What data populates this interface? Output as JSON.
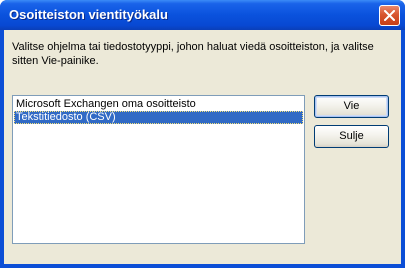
{
  "window": {
    "title": "Osoitteiston vientityökalu"
  },
  "dialog": {
    "instructions": "Valitse ohjelma tai tiedostotyyppi, johon haluat viedä osoitteiston, ja valitse sitten Vie-painike.",
    "list_items": [
      {
        "label": "Microsoft Exchangen oma osoitteisto",
        "selected": false
      },
      {
        "label": "Tekstitiedosto (CSV)",
        "selected": true
      }
    ],
    "buttons": {
      "export_label": "Vie",
      "close_label": "Sulje"
    }
  },
  "icons": {
    "close": "close-icon"
  },
  "colors": {
    "titlebar": "#0a52dd",
    "selection": "#316ac5",
    "dialog_bg": "#ece9d8",
    "close_button": "#d8552f"
  }
}
